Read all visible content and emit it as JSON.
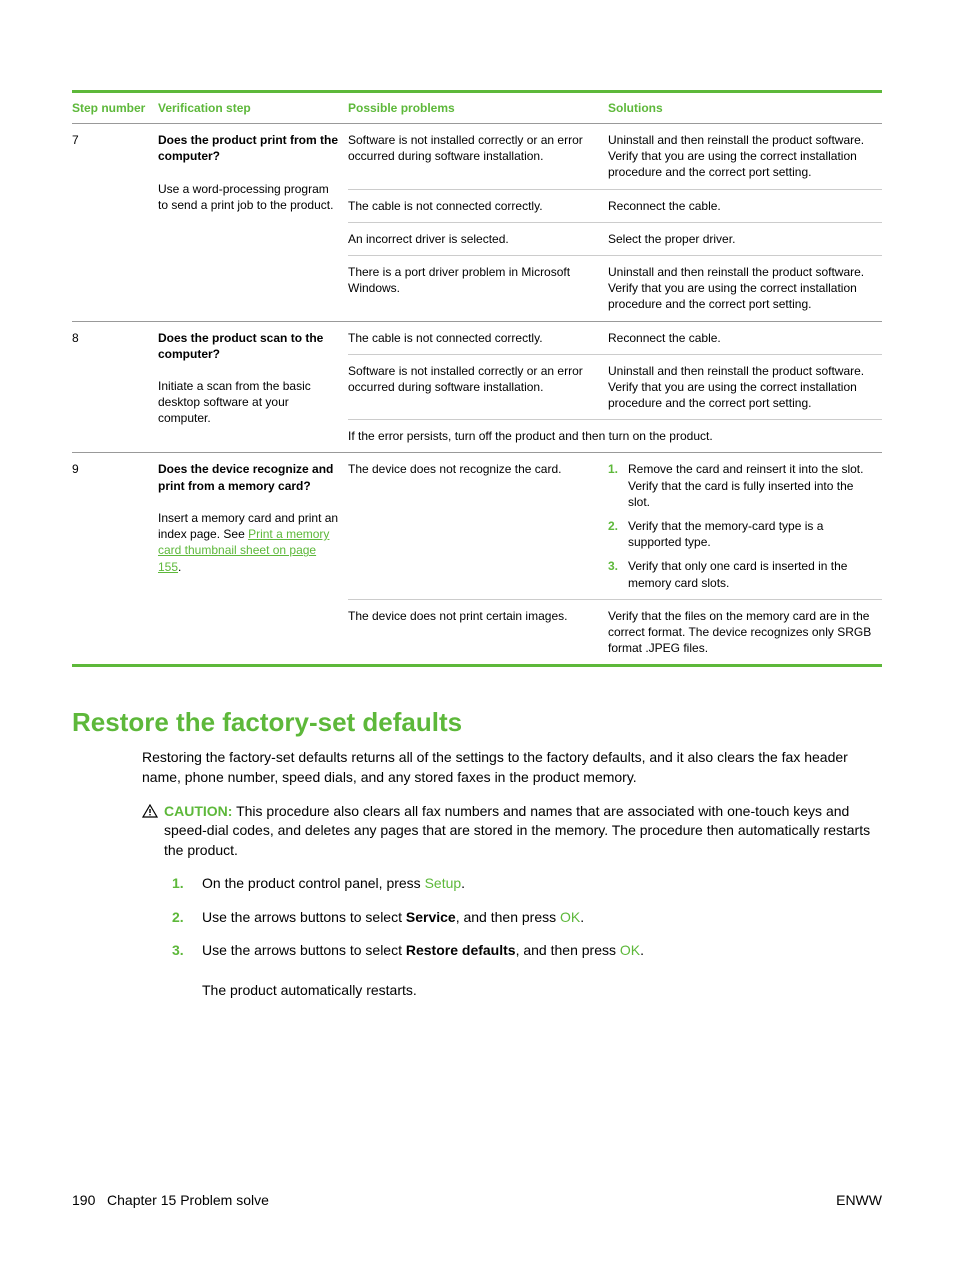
{
  "table": {
    "headers": {
      "step": "Step number",
      "verif": "Verification step",
      "prob": "Possible problems",
      "sol": "Solutions"
    },
    "row7": {
      "num": "7",
      "verif_bold": "Does the product print from the computer?",
      "verif_text": "Use a word-processing program to send a print job to the product.",
      "p1": "Software is not installed correctly or an error occurred during software installation.",
      "s1": "Uninstall and then reinstall the product software. Verify that you are using the correct installation procedure and the correct port setting.",
      "p2": "The cable is not connected correctly.",
      "s2": "Reconnect the cable.",
      "p3": "An incorrect driver is selected.",
      "s3": "Select the proper driver.",
      "p4": "There is a port driver problem in Microsoft Windows.",
      "s4": "Uninstall and then reinstall the product software. Verify that you are using the correct installation procedure and the correct port setting."
    },
    "row8": {
      "num": "8",
      "verif_bold": "Does the product scan to the computer?",
      "verif_text": "Initiate a scan from the basic desktop software at your computer.",
      "p1": "The cable is not connected correctly.",
      "s1": "Reconnect the cable.",
      "p2": "Software is not installed correctly or an error occurred during software installation.",
      "s2": "Uninstall and then reinstall the product software. Verify that you are using the correct installation procedure and the correct port setting.",
      "span": "If the error persists, turn off the product and then turn on the product."
    },
    "row9": {
      "num": "9",
      "verif_bold": "Does the device recognize and print from a memory card?",
      "verif_text1": "Insert a memory card and print an index page. See ",
      "verif_link": "Print a memory card thumbnail sheet on page 155",
      "verif_text2": ".",
      "p1": "The device does not recognize the card.",
      "s1_1": "Remove the card and reinsert it into the slot. Verify that the card is fully inserted into the slot.",
      "s1_2": "Verify that the memory-card type is a supported type.",
      "s1_3": "Verify that only one card is inserted in the memory card slots.",
      "p2": "The device does not print certain images.",
      "s2": "Verify that the files on the memory card are in the correct format. The device recognizes only SRGB format .JPEG files."
    }
  },
  "section": {
    "title": "Restore the factory-set defaults",
    "intro": "Restoring the factory-set defaults returns all of the settings to the factory defaults, and it also clears the fax header name, phone number, speed dials, and any stored faxes in the product memory.",
    "caution_label": "CAUTION:",
    "caution_text": "This procedure also clears all fax numbers and names that are associated with one-touch keys and speed-dial codes, and deletes any pages that are stored in the memory. The procedure then automatically restarts the product.",
    "step1_a": "On the product control panel, press ",
    "step1_b": "Setup",
    "step1_c": ".",
    "step2_a": "Use the arrows buttons to select ",
    "step2_b": "Service",
    "step2_c": ", and then press ",
    "step2_d": "OK",
    "step2_e": ".",
    "step3_a": "Use the arrows buttons to select ",
    "step3_b": "Restore defaults",
    "step3_c": ", and then press ",
    "step3_d": "OK",
    "step3_e": ".",
    "step_tail": "The product automatically restarts."
  },
  "footer": {
    "left_page": "190",
    "left_chapter": "Chapter 15   Problem solve",
    "right": "ENWW"
  }
}
